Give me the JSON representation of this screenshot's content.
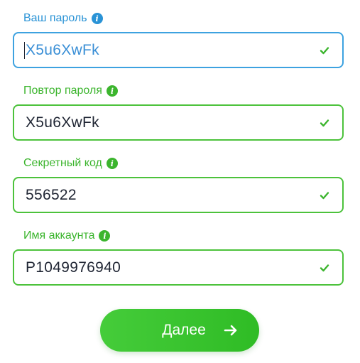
{
  "colors": {
    "blue_accent": "#3da2e0",
    "green_accent": "#4cc23b",
    "button_green": "#3cc42f"
  },
  "fields": [
    {
      "label": "Ваш пароль",
      "value": "X5u6XwFk",
      "state": "focused",
      "info_icon": "info-icon",
      "status_icon": "check-icon"
    },
    {
      "label": "Повтор пароля",
      "value": "X5u6XwFk",
      "state": "valid",
      "info_icon": "info-icon",
      "status_icon": "check-icon"
    },
    {
      "label": "Секретный код",
      "value": "556522",
      "state": "valid",
      "info_icon": "info-icon",
      "status_icon": "check-icon"
    },
    {
      "label": "Имя аккаунта",
      "value": "P1049976940",
      "state": "valid",
      "info_icon": "info-icon",
      "status_icon": "check-icon"
    }
  ],
  "next_button": {
    "label": "Далее",
    "icon": "arrow-right-icon"
  }
}
